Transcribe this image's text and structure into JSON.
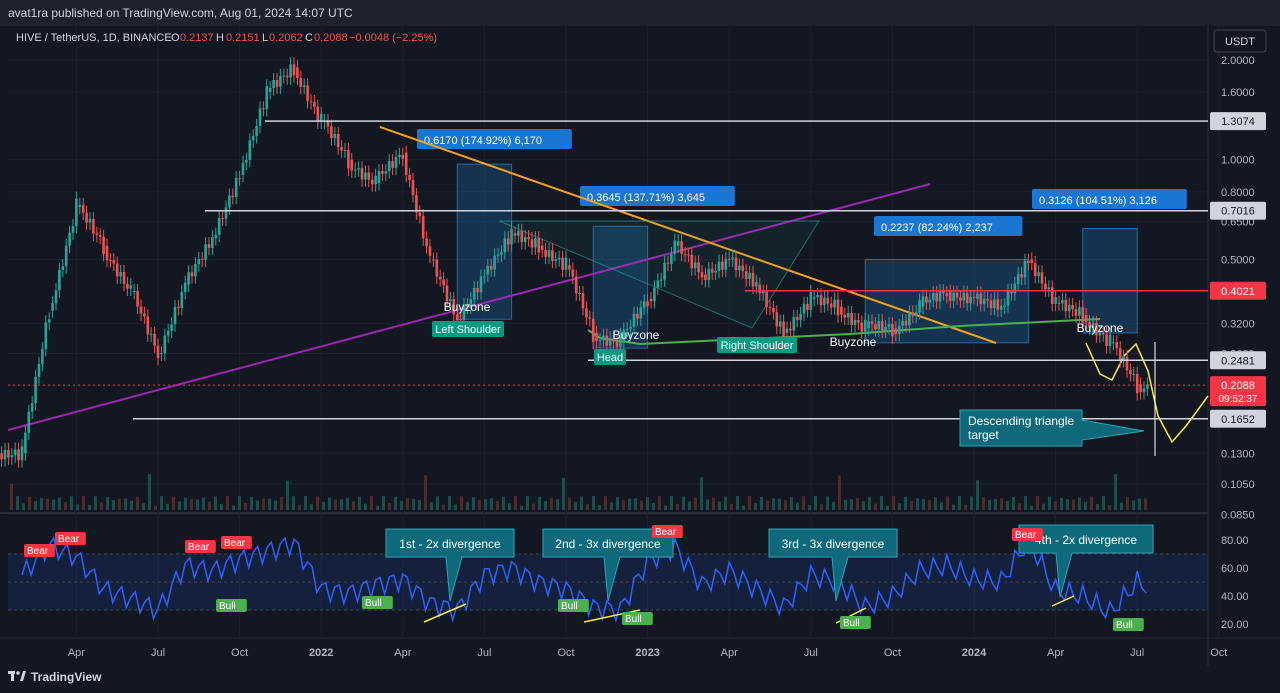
{
  "header": {
    "published": "avat1ra published on TradingView.com, Aug 01, 2024 14:07 UTC"
  },
  "footer": {
    "brand": "TradingView"
  },
  "colors": {
    "background": "#131722",
    "up": "#26a69a",
    "down": "#ef5350",
    "rsi": "#2962ff",
    "trendline": "#f7a21b",
    "support_line": "#9c27b0",
    "neckline": "#4caf50",
    "projection": "#ffeb3b"
  },
  "price_header": {
    "symbol": "HIVE / TetherUS, 1D, BINANCE",
    "o_label": "O",
    "o": "0.2137",
    "h_label": "H",
    "h": "0.2151",
    "l_label": "L",
    "l": "0.2062",
    "c_label": "C",
    "c": "0.2088",
    "change": "−0.0048 (−2.25%)"
  },
  "chart_data": [
    {
      "type": "candlestick",
      "title": "HIVE / TetherUS, 1D, BINANCE",
      "scale": "log",
      "currency": "USDT",
      "y_ticks": [
        "2.0000",
        "1.6000",
        "1.0000",
        "0.8000",
        "0.6500",
        "0.5000",
        "0.3200",
        "0.2600",
        "0.1300",
        "0.1050",
        "0.0850"
      ],
      "x_ticks": [
        "Apr",
        "Jul",
        "Oct",
        "2022",
        "Apr",
        "Jul",
        "Oct",
        "2023",
        "Apr",
        "Jul",
        "Oct",
        "2024",
        "Apr",
        "Jul",
        "Oct"
      ],
      "price_series": {
        "x": [
          "2021-02",
          "2021-03",
          "2021-04",
          "2021-05",
          "2021-06",
          "2021-07",
          "2021-08",
          "2021-09",
          "2021-10",
          "2021-11",
          "2021-12",
          "2022-01",
          "2022-02",
          "2022-03",
          "2022-04",
          "2022-05",
          "2022-06",
          "2022-07",
          "2022-08",
          "2022-09",
          "2022-10",
          "2022-11",
          "2022-12",
          "2023-01",
          "2023-02",
          "2023-03",
          "2023-04",
          "2023-05",
          "2023-06",
          "2023-07",
          "2023-08",
          "2023-09",
          "2023-10",
          "2023-11",
          "2023-12",
          "2024-01",
          "2024-02",
          "2024-03",
          "2024-04",
          "2024-05",
          "2024-06",
          "2024-07",
          "2024-08"
        ],
        "close": [
          0.13,
          0.35,
          0.72,
          0.55,
          0.4,
          0.26,
          0.42,
          0.58,
          0.9,
          1.6,
          1.9,
          1.3,
          1.0,
          0.85,
          1.05,
          0.5,
          0.33,
          0.45,
          0.6,
          0.55,
          0.48,
          0.3,
          0.28,
          0.38,
          0.55,
          0.45,
          0.5,
          0.42,
          0.3,
          0.38,
          0.36,
          0.31,
          0.31,
          0.36,
          0.4,
          0.38,
          0.36,
          0.5,
          0.37,
          0.34,
          0.28,
          0.21,
          0.2088
        ]
      },
      "levels": [
        {
          "value": "1.3074",
          "color": "#d1d4dc"
        },
        {
          "value": "0.7016",
          "color": "#d1d4dc"
        },
        {
          "value": "0.4021",
          "color": "#f23645"
        },
        {
          "value": "0.2481",
          "color": "#d1d4dc"
        },
        {
          "value": "0.1652",
          "color": "#d1d4dc"
        }
      ],
      "last_price": {
        "value": "0.2088",
        "countdown": "09:52:37",
        "color": "#f23645"
      },
      "measurements": [
        {
          "label": "0.6170 (174.92%) 6,170"
        },
        {
          "label": "0.3645 (137.71%) 3,645"
        },
        {
          "label": "0.2237 (82.24%) 2,237"
        },
        {
          "label": "0.3126 (104.51%) 3,126"
        }
      ],
      "annotations": {
        "buyzone": "Buyzone",
        "left_shoulder": "Left Shoulder",
        "head": "Head",
        "right_shoulder": "Right Shoulder",
        "callout_line1": "Descending triangle",
        "callout_line2": "target"
      }
    },
    {
      "type": "line",
      "title": "RSI",
      "y_ticks": [
        "80.00",
        "60.00",
        "40.00",
        "20.00"
      ],
      "bands": [
        30,
        50,
        70
      ],
      "series": {
        "x": [
          "2021-02",
          "2021-03",
          "2021-04",
          "2021-05",
          "2021-06",
          "2021-07",
          "2021-08",
          "2021-09",
          "2021-10",
          "2021-11",
          "2021-12",
          "2022-01",
          "2022-02",
          "2022-03",
          "2022-04",
          "2022-05",
          "2022-06",
          "2022-07",
          "2022-08",
          "2022-09",
          "2022-10",
          "2022-11",
          "2022-12",
          "2023-01",
          "2023-02",
          "2023-03",
          "2023-04",
          "2023-05",
          "2023-06",
          "2023-07",
          "2023-08",
          "2023-09",
          "2023-10",
          "2023-11",
          "2023-12",
          "2024-01",
          "2024-02",
          "2024-03",
          "2024-04",
          "2024-05",
          "2024-06",
          "2024-07",
          "2024-08"
        ],
        "values": [
          55,
          76,
          68,
          45,
          38,
          30,
          62,
          58,
          66,
          72,
          78,
          45,
          42,
          48,
          52,
          35,
          30,
          55,
          60,
          50,
          45,
          32,
          30,
          65,
          75,
          48,
          58,
          45,
          32,
          55,
          50,
          32,
          40,
          58,
          62,
          52,
          50,
          80,
          44,
          40,
          28,
          50,
          42
        ]
      },
      "divergence_labels": [
        "1st - 2x divergence",
        "2nd - 3x divergence",
        "3rd - 3x divergence",
        "4th - 2x divergence"
      ],
      "signal_labels": {
        "bear": "Bear",
        "bull": "Bull"
      }
    }
  ]
}
